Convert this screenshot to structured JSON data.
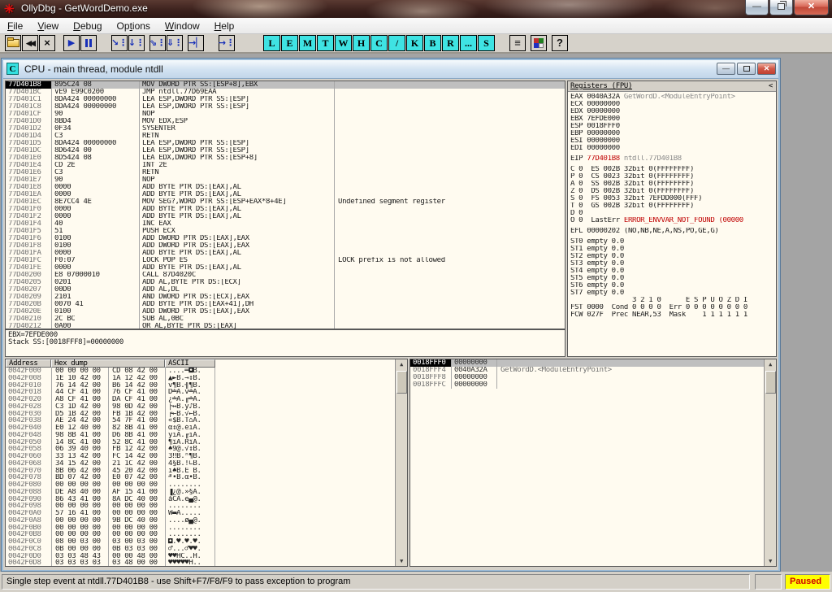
{
  "palette": {
    "pane_bg": "#fffbf0",
    "chrome_gray": "#d4d0c8",
    "selection_gray": "#bfbfbf",
    "alert_red": "#c00000",
    "paused_bg": "#ffff00",
    "paused_fg": "#d00000",
    "viewer_button_cyan": "#3fe3e3"
  },
  "window": {
    "title": "OllyDbg - GetWordDemo.exe",
    "status_left": "Single step event at ntdll.77D401B8 - use Shift+F7/F8/F9 to pass exception to program",
    "status_mid": "",
    "status_state": "Paused"
  },
  "menu": {
    "items": [
      {
        "label": "File",
        "u": 0
      },
      {
        "label": "View",
        "u": 0
      },
      {
        "label": "Debug",
        "u": 0
      },
      {
        "label": "Options",
        "u": 2
      },
      {
        "label": "Window",
        "u": 0
      },
      {
        "label": "Help",
        "u": 0
      }
    ]
  },
  "toolbar": {
    "glyphs": {
      "restart": "◀◀",
      "close": "×",
      "run": "▶",
      "step_into": "↘⋮",
      "step_over": "↓⋮",
      "animate_into": "⇘⋮",
      "animate_over": "⇓⋮",
      "execute_till_return": "→▏",
      "execute_till_user": "→⋮",
      "windows_list": "≡",
      "help": "?"
    },
    "viewer_buttons": [
      {
        "label": "L"
      },
      {
        "label": "E"
      },
      {
        "label": "M"
      },
      {
        "label": "T"
      },
      {
        "label": "W"
      },
      {
        "label": "H"
      },
      {
        "label": "C"
      },
      {
        "label": "/"
      },
      {
        "label": "K"
      },
      {
        "label": "B"
      },
      {
        "label": "R"
      },
      {
        "label": "..."
      },
      {
        "label": "S"
      }
    ]
  },
  "cpu": {
    "title": "CPU - main thread, module ntdll",
    "icon_letter": "C",
    "disasm": {
      "rows": [
        {
          "addr": "77D401B8",
          "hex": "895C24 08",
          "ins": "MOV DWORD PTR SS:[ESP+8],EBX",
          "comment": "",
          "sel": "sel"
        },
        {
          "addr": "77D401BC",
          "hex": "∨E9 E99C0200",
          "ins": "JMP ntdll.77D69EAA",
          "comment": ""
        },
        {
          "addr": "77D401C1",
          "hex": "8DA424 00000000",
          "ins": "LEA ESP,DWORD PTR SS:[ESP]",
          "comment": ""
        },
        {
          "addr": "77D401C8",
          "hex": "8DA424 00000000",
          "ins": "LEA ESP,DWORD PTR SS:[ESP]",
          "comment": ""
        },
        {
          "addr": "77D401CF",
          "hex": "90",
          "ins": "NOP",
          "comment": ""
        },
        {
          "addr": "77D401D0",
          "hex": "8BD4",
          "ins": "MOV EDX,ESP",
          "comment": ""
        },
        {
          "addr": "77D401D2",
          "hex": "0F34",
          "ins": "SYSENTER",
          "comment": ""
        },
        {
          "addr": "77D401D4",
          "hex": "C3",
          "ins": "RETN",
          "comment": ""
        },
        {
          "addr": "77D401D5",
          "hex": "8DA424 00000000",
          "ins": "LEA ESP,DWORD PTR SS:[ESP]",
          "comment": ""
        },
        {
          "addr": "77D401DC",
          "hex": "8D6424 00",
          "ins": "LEA ESP,DWORD PTR SS:[ESP]",
          "comment": ""
        },
        {
          "addr": "77D401E0",
          "hex": "8D5424 08",
          "ins": "LEA EDX,DWORD PTR SS:[ESP+8]",
          "comment": ""
        },
        {
          "addr": "77D401E4",
          "hex": "CD 2E",
          "ins": "INT 2E",
          "comment": ""
        },
        {
          "addr": "77D401E6",
          "hex": "C3",
          "ins": "RETN",
          "comment": ""
        },
        {
          "addr": "77D401E7",
          "hex": "90",
          "ins": "NOP",
          "comment": ""
        },
        {
          "addr": "77D401E8",
          "hex": "0000",
          "ins": "ADD BYTE PTR DS:[EAX],AL",
          "comment": ""
        },
        {
          "addr": "77D401EA",
          "hex": "0000",
          "ins": "ADD BYTE PTR DS:[EAX],AL",
          "comment": ""
        },
        {
          "addr": "77D401EC",
          "hex": "8E7CC4 4E",
          "ins": "MOV SEG?,WORD PTR SS:[ESP+EAX*8+4E]",
          "comment": "Undefined segment register"
        },
        {
          "addr": "77D401F0",
          "hex": "0000",
          "ins": "ADD BYTE PTR DS:[EAX],AL",
          "comment": ""
        },
        {
          "addr": "77D401F2",
          "hex": "0000",
          "ins": "ADD BYTE PTR DS:[EAX],AL",
          "comment": ""
        },
        {
          "addr": "77D401F4",
          "hex": "40",
          "ins": "INC EAX",
          "comment": ""
        },
        {
          "addr": "77D401F5",
          "hex": "51",
          "ins": "PUSH ECX",
          "comment": ""
        },
        {
          "addr": "77D401F6",
          "hex": "0100",
          "ins": "ADD DWORD PTR DS:[EAX],EAX",
          "comment": ""
        },
        {
          "addr": "77D401F8",
          "hex": "0100",
          "ins": "ADD DWORD PTR DS:[EAX],EAX",
          "comment": ""
        },
        {
          "addr": "77D401FA",
          "hex": "0000",
          "ins": "ADD BYTE PTR DS:[EAX],AL",
          "comment": ""
        },
        {
          "addr": "77D401FC",
          "hex": "F0:07",
          "ins": "LOCK POP ES",
          "comment": "LOCK prefix is not allowed"
        },
        {
          "addr": "77D401FE",
          "hex": "0000",
          "ins": "ADD BYTE PTR DS:[EAX],AL",
          "comment": ""
        },
        {
          "addr": "77D40200",
          "hex": "E8 07000010",
          "ins": "CALL 87D4020C",
          "comment": ""
        },
        {
          "addr": "77D40205",
          "hex": "0201",
          "ins": "ADD AL,BYTE PTR DS:[ECX]",
          "comment": ""
        },
        {
          "addr": "77D40207",
          "hex": "00D0",
          "ins": "ADD AL,DL",
          "comment": ""
        },
        {
          "addr": "77D40209",
          "hex": "2101",
          "ins": "AND DWORD PTR DS:[ECX],EAX",
          "comment": ""
        },
        {
          "addr": "77D4020B",
          "hex": "0070 41",
          "ins": "ADD BYTE PTR DS:[EAX+41],DH",
          "comment": ""
        },
        {
          "addr": "77D4020E",
          "hex": "0100",
          "ins": "ADD DWORD PTR DS:[EAX],EAX",
          "comment": ""
        },
        {
          "addr": "77D40210",
          "hex": "2C BC",
          "ins": "SUB AL,0BC",
          "comment": ""
        },
        {
          "addr": "77D40212",
          "hex": "0A00",
          "ins": "OR AL,BYTE PTR DS:[EAX]",
          "comment": ""
        }
      ]
    },
    "info": [
      {
        "t": "EBX=7EFDE000"
      },
      {
        "t": "Stack SS:[0018FFF8]=00000000"
      }
    ],
    "registers": {
      "header": "Registers (FPU)",
      "collapse": "<",
      "gpr": [
        {
          "t": "EAX 0040A32A",
          "c": " GetWordD.<ModuleEntryPoint>"
        },
        {
          "t": "ECX 00000000",
          "c": ""
        },
        {
          "t": "EDX 00000000",
          "c": ""
        },
        {
          "t": "EBX 7EFDE000",
          "c": ""
        },
        {
          "t": "ESP 0018FFF0",
          "c": ""
        },
        {
          "t": "EBP 00000000",
          "c": ""
        },
        {
          "t": "ESI 00000000",
          "c": ""
        },
        {
          "t": "EDI 00000000",
          "c": ""
        }
      ],
      "eip": {
        "t": "EIP ",
        "v": "77D401B8",
        "c": " ntdll.77D401B8"
      },
      "flags": [
        {
          "t": "C 0  ES 002B 32bit 0(FFFFFFFF)"
        },
        {
          "t": "P 0  CS 0023 32bit 0(FFFFFFFF)"
        },
        {
          "t": "A 0  SS 002B 32bit 0(FFFFFFFF)"
        },
        {
          "t": "Z 0  DS 002B 32bit 0(FFFFFFFF)"
        },
        {
          "t": "S 0  FS 0053 32bit 7EFDD000(FFF)"
        },
        {
          "t": "T 0  GS 002B 32bit 0(FFFFFFFF)"
        },
        {
          "t": "D 0"
        }
      ],
      "lasterr": {
        "t": "O 0  LastErr ",
        "v": "ERROR_ENVVAR_NOT_FOUND (00000"
      },
      "efl": "EFL 00000202 (NO,NB,NE,A,NS,PO,GE,G)",
      "fpu": [
        {
          "t": "ST0 empty 0.0"
        },
        {
          "t": "ST1 empty 0.0"
        },
        {
          "t": "ST2 empty 0.0"
        },
        {
          "t": "ST3 empty 0.0"
        },
        {
          "t": "ST4 empty 0.0"
        },
        {
          "t": "ST5 empty 0.0"
        },
        {
          "t": "ST6 empty 0.0"
        },
        {
          "t": "ST7 empty 0.0"
        }
      ],
      "fst_header": "               3 2 1 0      E S P U O Z D I",
      "fst": "FST 0000  Cond 0 0 0 0  Err 0 0 0 0 0 0 0 0",
      "fcw": "FCW 027F  Prec NEAR,53  Mask    1 1 1 1 1 1"
    },
    "dump": {
      "headers": {
        "address": "Address",
        "hex": "Hex dump",
        "ascii": "ASCII"
      },
      "rows": [
        {
          "addr": "0042F000",
          "b1": "00 00 00 00",
          "b2": "CD 08 42 00",
          "ascii": "....═◘B."
        },
        {
          "addr": "0042F008",
          "b1": "1E 10 42 00",
          "b2": "1A 12 42 00",
          "ascii": "▲►B.→↕B."
        },
        {
          "addr": "0042F010",
          "b1": "76 14 42 00",
          "b2": "B6 14 42 00",
          "ascii": "v¶B.╢¶B."
        },
        {
          "addr": "0042F018",
          "b1": "44 CF 41 00",
          "b2": "76 CF 41 00",
          "ascii": "D╧A.v╧A."
        },
        {
          "addr": "0042F020",
          "b1": "A8 CF 41 00",
          "b2": "DA CF 41 00",
          "ascii": "¿╧A.╓╧A."
        },
        {
          "addr": "0042F028",
          "b1": "C3 1D 42 00",
          "b2": "98 0D 42 00",
          "ascii": "├↔B.ÿ♪B."
        },
        {
          "addr": "0042F030",
          "b1": "D5 1B 42 00",
          "b2": "FB 1B 42 00",
          "ascii": "╒←B.√←B."
        },
        {
          "addr": "0042F038",
          "b1": "AE 24 42 00",
          "b2": "54 7F 41 00",
          "ascii": "«$B.T⌂A."
        },
        {
          "addr": "0042F040",
          "b1": "E0 12 40 00",
          "b2": "82 8B 41 00",
          "ascii": "α↕@.éïA."
        },
        {
          "addr": "0042F048",
          "b1": "98 8B 41 00",
          "b2": "D6 8B 41 00",
          "ascii": "ÿïA.╓ïA."
        },
        {
          "addr": "0042F050",
          "b1": "14 8C 41 00",
          "b2": "52 8C 41 00",
          "ascii": "¶îA.RîA."
        },
        {
          "addr": "0042F058",
          "b1": "06 39 40 00",
          "b2": "FB 12 42 00",
          "ascii": "♠9@.√↕B."
        },
        {
          "addr": "0042F060",
          "b1": "33 13 42 00",
          "b2": "FC 14 42 00",
          "ascii": "3‼B.ⁿ¶B."
        },
        {
          "addr": "0042F068",
          "b1": "34 15 42 00",
          "b2": "21 1C 42 00",
          "ascii": "4§B.!∟B."
        },
        {
          "addr": "0042F070",
          "b1": "8B 06 42 00",
          "b2": "45 20 42 00",
          "ascii": "ï♠B.E B."
        },
        {
          "addr": "0042F078",
          "b1": "BD 07 42 00",
          "b2": "E0 07 42 00",
          "ascii": "╜•B.α•B."
        },
        {
          "addr": "0042F080",
          "b1": "00 00 00 00",
          "b2": "00 00 00 00",
          "ascii": "........"
        },
        {
          "addr": "0042F088",
          "b1": "DE A8 40 00",
          "b2": "AF 15 41 00",
          "ascii": "▐¿@.»§A."
        },
        {
          "addr": "0042F090",
          "b1": "86 43 41 00",
          "b2": "8A DC 40 00",
          "ascii": "åCA.è▄@."
        },
        {
          "addr": "0042F098",
          "b1": "00 00 00 00",
          "b2": "00 00 00 00",
          "ascii": "........"
        },
        {
          "addr": "0042F0A0",
          "b1": "57 16 41 00",
          "b2": "00 00 00 00",
          "ascii": "W▬A....."
        },
        {
          "addr": "0042F0A8",
          "b1": "00 00 00 00",
          "b2": "9B DC 40 00",
          "ascii": "....ø▄@."
        },
        {
          "addr": "0042F0B0",
          "b1": "00 00 00 00",
          "b2": "00 00 00 00",
          "ascii": "........"
        },
        {
          "addr": "0042F0B8",
          "b1": "00 00 00 00",
          "b2": "00 00 00 00",
          "ascii": "........"
        },
        {
          "addr": "0042F0C0",
          "b1": "08 00 03 00",
          "b2": "03 00 03 00",
          "ascii": "◘.♥.♥.♥."
        },
        {
          "addr": "0042F0C8",
          "b1": "0B 00 00 00",
          "b2": "0B 03 03 00",
          "ascii": "♂...♂♥♥."
        },
        {
          "addr": "0042F0D0",
          "b1": "03 03 48 43",
          "b2": "00 00 48 00",
          "ascii": "♥♥HC..H."
        },
        {
          "addr": "0042F0D8",
          "b1": "03 03 03 03",
          "b2": "03 48 00 00",
          "ascii": "♥♥♥♥♥H.."
        }
      ]
    },
    "stack": {
      "rows": [
        {
          "addr": "0018FFF0",
          "val": "00000000",
          "comment": "",
          "sel": "sel"
        },
        {
          "addr": "0018FFF4",
          "val": "0040A32A",
          "comment": "GetWordD.<ModuleEntryPoint>"
        },
        {
          "addr": "0018FFF8",
          "val": "00000000",
          "comment": ""
        },
        {
          "addr": "0018FFFC",
          "val": "00000000",
          "comment": ""
        }
      ]
    }
  }
}
